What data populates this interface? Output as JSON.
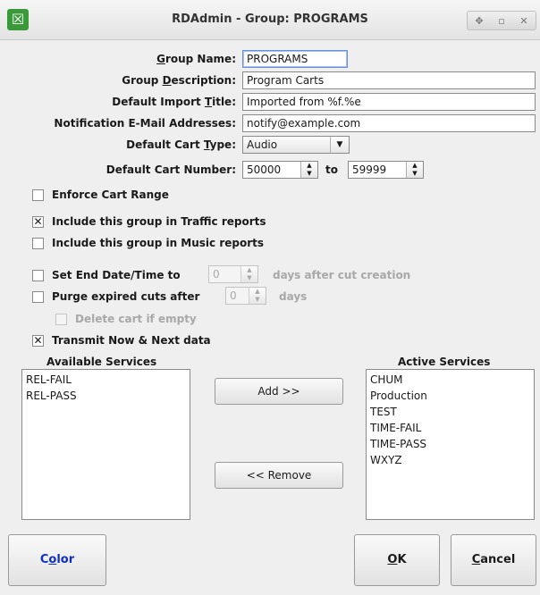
{
  "window": {
    "title": "RDAdmin - Group: PROGRAMS",
    "app_icon": "rdadmin-logo-icon",
    "controls": [
      "restore-icon",
      "maximize-icon",
      "close-icon"
    ]
  },
  "form": {
    "group_name": {
      "label_pre": "",
      "label_u": "G",
      "label_post": "roup Name:",
      "value": "PROGRAMS"
    },
    "group_description": {
      "label_pre": "Group ",
      "label_u": "D",
      "label_post": "escription:",
      "value": "Program Carts"
    },
    "default_import_title": {
      "label_pre": "Default Import ",
      "label_u": "T",
      "label_post": "itle:",
      "value": "Imported from %f.%e"
    },
    "notification_emails": {
      "label": "Notification E-Mail Addresses:",
      "value": "notify@example.com"
    },
    "default_cart_type": {
      "label_pre": "Default Cart ",
      "label_u": "T",
      "label_post": "ype:",
      "value": "Audio"
    },
    "default_cart_number": {
      "label": "Default Cart Number:",
      "from": "50000",
      "to_label": "to",
      "to": "59999"
    }
  },
  "options": {
    "enforce_cart_range": {
      "label": "Enforce Cart Range",
      "checked": false
    },
    "traffic_reports": {
      "label": "Include this group in Traffic reports",
      "checked": true
    },
    "music_reports": {
      "label": "Include this group in Music reports",
      "checked": false
    },
    "set_end_datetime": {
      "label": "Set End Date/Time to",
      "value": "0",
      "suffix": "days after cut creation",
      "checked": false
    },
    "purge_expired": {
      "label": "Purge expired cuts after",
      "value": "0",
      "suffix": "days",
      "checked": false
    },
    "delete_cart_if_empty": {
      "label": "Delete cart if empty",
      "checked": false
    },
    "transmit_now_next": {
      "label": "Transmit Now & Next data",
      "checked": true
    }
  },
  "services": {
    "available_label": "Available Services",
    "available": [
      "REL-FAIL",
      "REL-PASS"
    ],
    "active_label": "Active Services",
    "active": [
      "CHUM",
      "Production",
      "TEST",
      "TIME-FAIL",
      "TIME-PASS",
      "WXYZ"
    ],
    "add_label": "Add >>",
    "remove_label": "<< Remove"
  },
  "buttons": {
    "color_pre": "C",
    "color_u": "o",
    "color_post": "lor",
    "ok_u": "O",
    "ok_post": "K",
    "cancel_u": "C",
    "cancel_post": "ancel"
  }
}
